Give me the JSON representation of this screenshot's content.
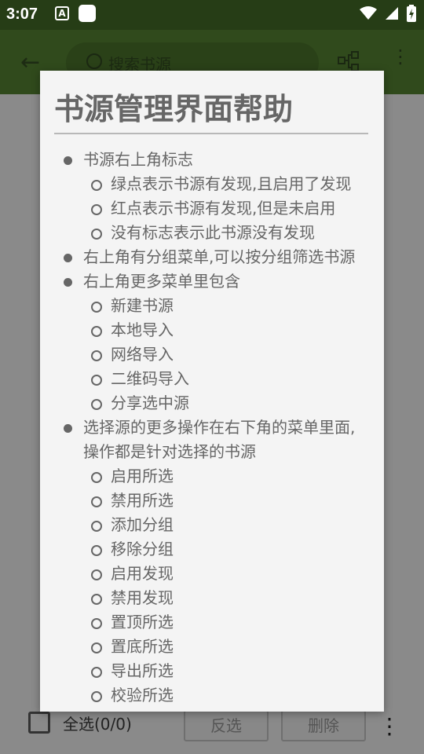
{
  "status_bar": {
    "time": "3:07",
    "icons": [
      "a-badge-icon",
      "app-square-icon",
      "wifi-icon",
      "signal-icon",
      "battery-charging-icon"
    ],
    "letter": "A"
  },
  "toolbar": {
    "search_placeholder": "搜索书源",
    "icons": [
      "back-arrow-icon",
      "search-icon",
      "group-icon",
      "more-vert-icon"
    ]
  },
  "dialog": {
    "title": "书源管理界面帮助",
    "items": [
      {
        "text": "书源右上角标志",
        "level": 1
      },
      {
        "text": "绿点表示书源有发现,且启用了发现",
        "level": 2
      },
      {
        "text": "红点表示书源有发现,但是未启用",
        "level": 2
      },
      {
        "text": "没有标志表示此书源没有发现",
        "level": 2
      },
      {
        "text": "右上角有分组菜单,可以按分组筛选书源",
        "level": 1
      },
      {
        "text": "右上角更多菜单里包含",
        "level": 1
      },
      {
        "text": "新建书源",
        "level": 2
      },
      {
        "text": "本地导入",
        "level": 2
      },
      {
        "text": "网络导入",
        "level": 2
      },
      {
        "text": "二维码导入",
        "level": 2
      },
      {
        "text": "分享选中源",
        "level": 2
      },
      {
        "text": "选择源的更多操作在右下角的菜单里面,",
        "level": 1
      },
      {
        "text": "操作都是针对选择的书源",
        "level": 0
      },
      {
        "text": "启用所选",
        "level": 2
      },
      {
        "text": "禁用所选",
        "level": 2
      },
      {
        "text": "添加分组",
        "level": 2
      },
      {
        "text": "移除分组",
        "level": 2
      },
      {
        "text": "启用发现",
        "level": 2
      },
      {
        "text": "禁用发现",
        "level": 2
      },
      {
        "text": "置顶所选",
        "level": 2
      },
      {
        "text": "置底所选",
        "level": 2
      },
      {
        "text": "导出所选",
        "level": 2
      },
      {
        "text": "校验所选",
        "level": 2
      }
    ]
  },
  "bottom_bar": {
    "select_all": "全选(0/0)",
    "invert": "反选",
    "delete": "删除"
  },
  "colors": {
    "toolbar": "#304a1c",
    "status_bar": "#263d16",
    "dialog_bg": "#f4f4f4",
    "text": "#666666"
  }
}
